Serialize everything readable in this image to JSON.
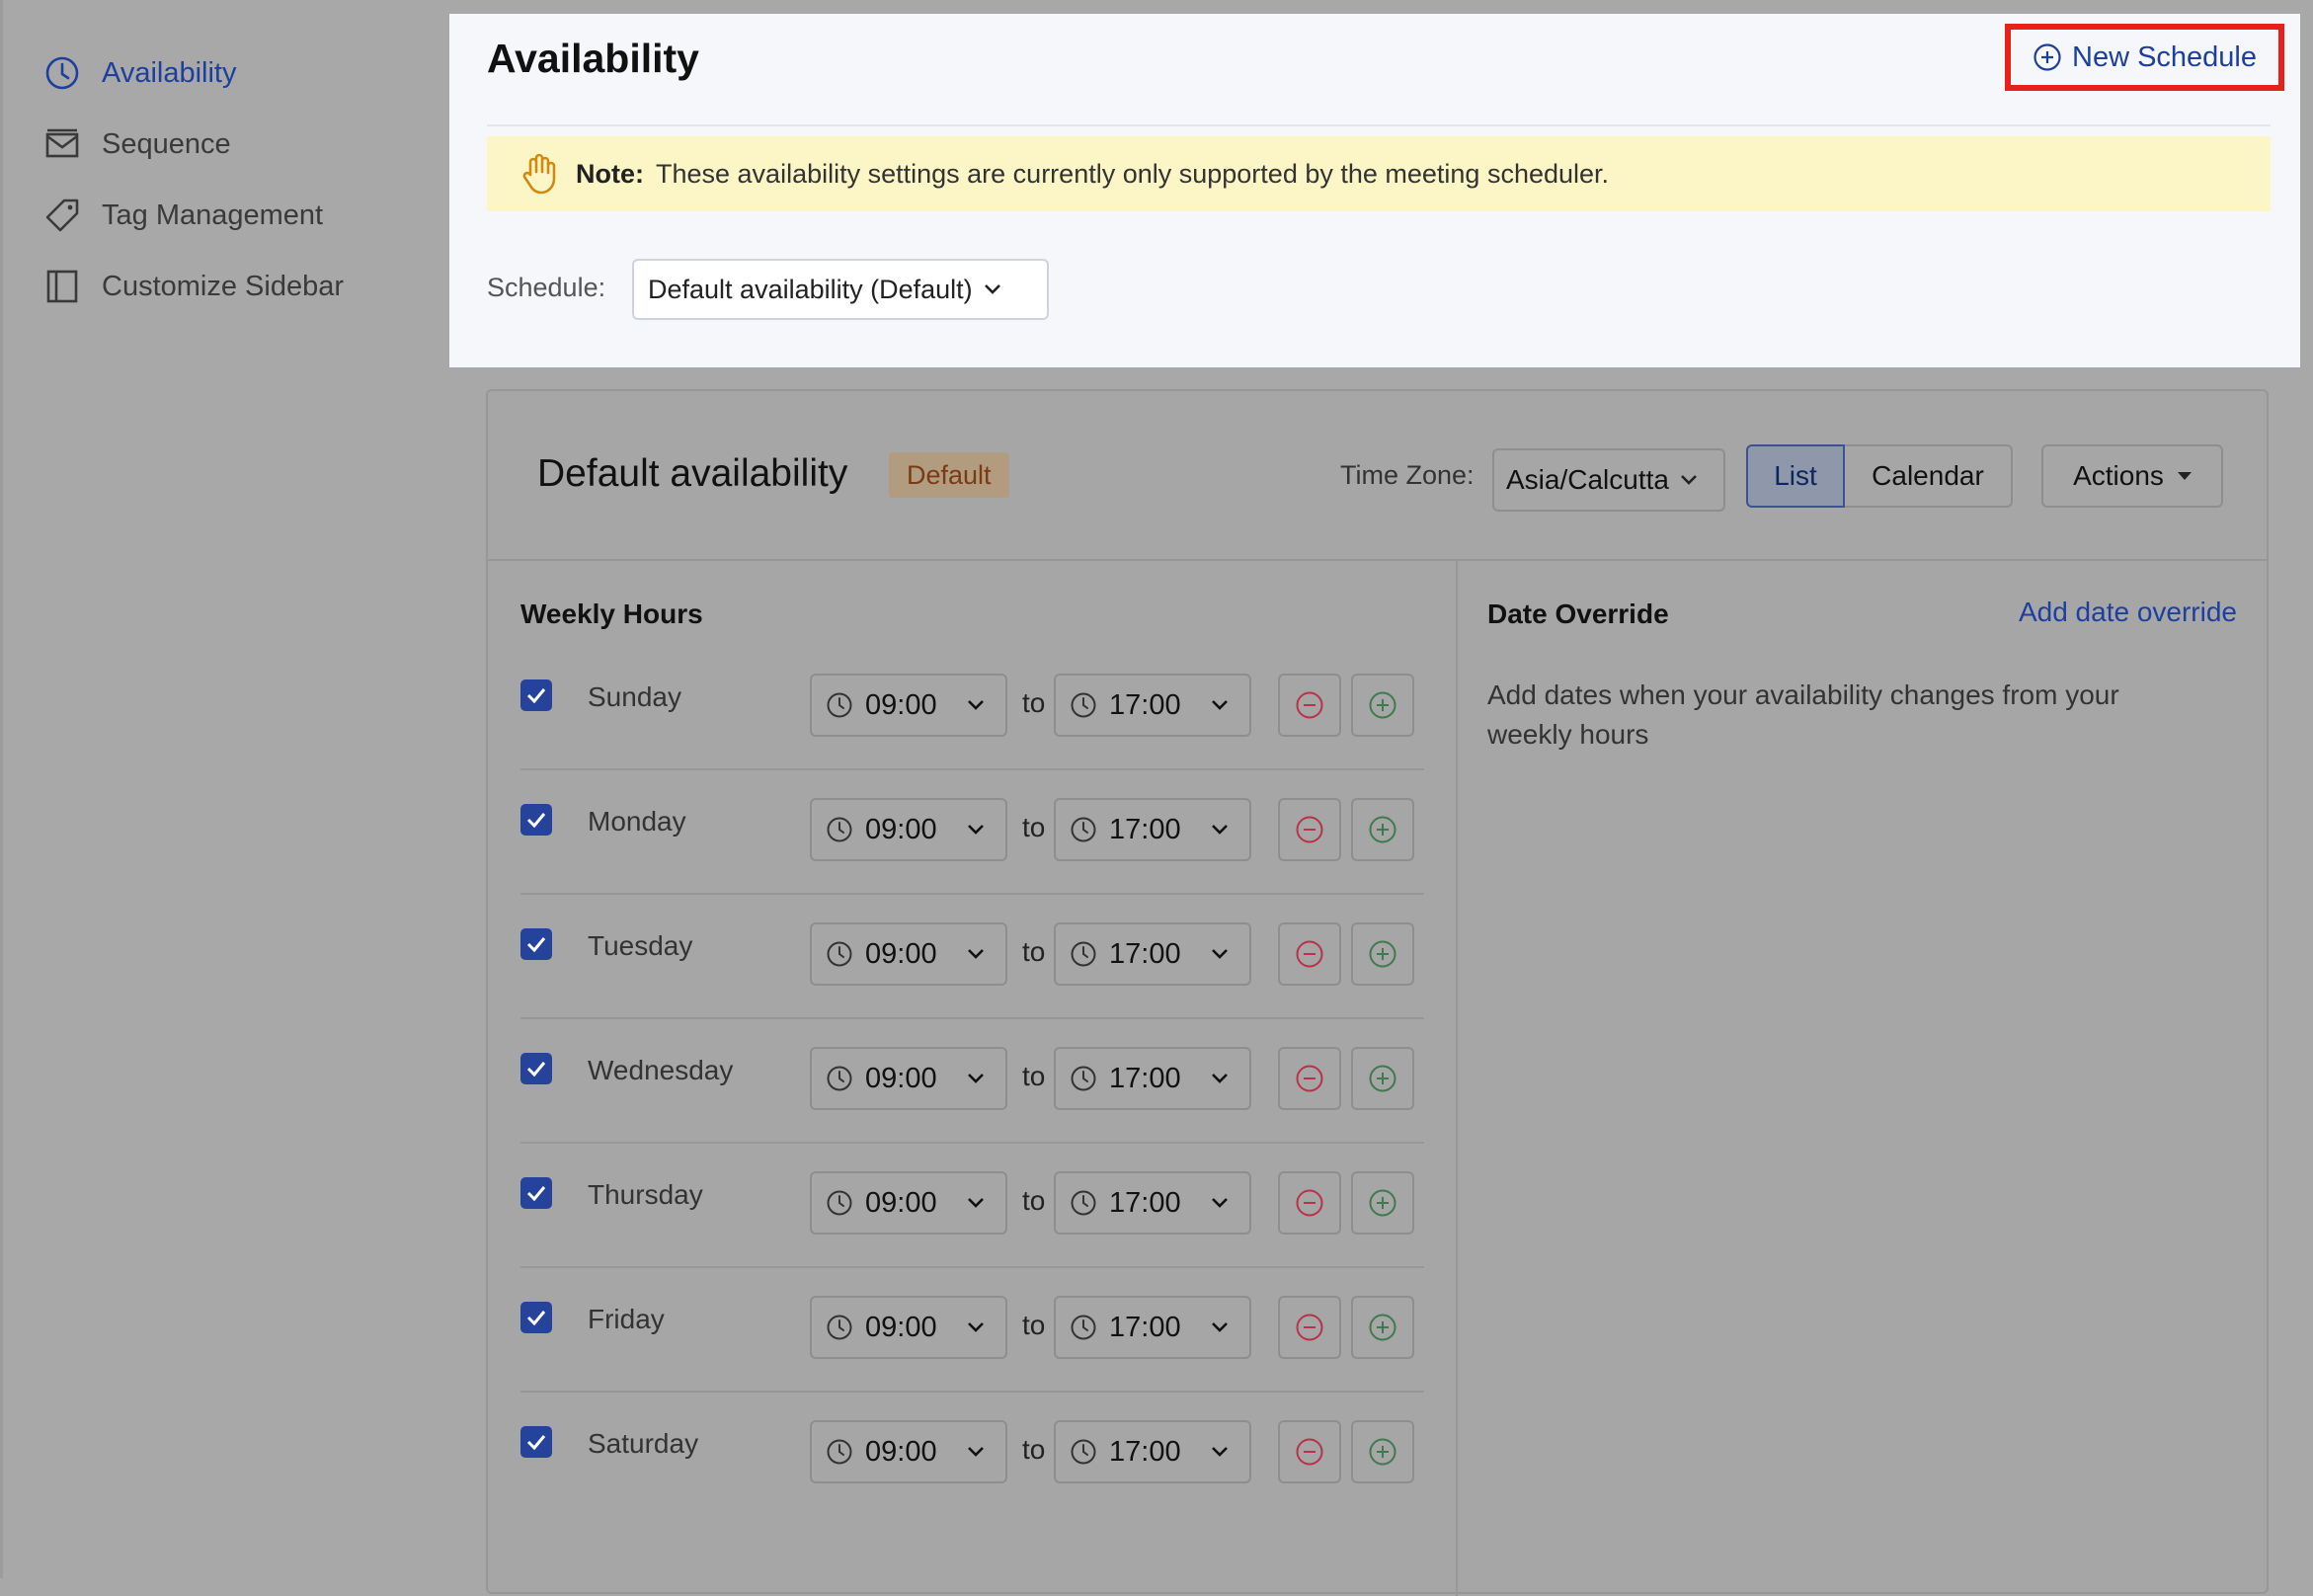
{
  "sidebar": {
    "items": [
      {
        "label": "Availability",
        "icon": "clock-icon",
        "active": true
      },
      {
        "label": "Sequence",
        "icon": "mail-icon",
        "active": false
      },
      {
        "label": "Tag Management",
        "icon": "tag-icon",
        "active": false
      },
      {
        "label": "Customize Sidebar",
        "icon": "sidebar-layout-icon",
        "active": false
      }
    ]
  },
  "header": {
    "title": "Availability",
    "new_schedule_label": "New Schedule",
    "note_bold": "Note:",
    "note_text": "These availability settings are currently only supported by the meeting scheduler.",
    "schedule_label": "Schedule:",
    "schedule_value": "Default availability (Default)"
  },
  "card": {
    "title": "Default availability",
    "badge": "Default",
    "timezone_label": "Time Zone:",
    "timezone_value": "Asia/Calcutta",
    "view_list": "List",
    "view_calendar": "Calendar",
    "actions_label": "Actions"
  },
  "weekly": {
    "title": "Weekly Hours",
    "to_label": "to",
    "days": [
      {
        "day": "Sunday",
        "checked": true,
        "start": "09:00",
        "end": "17:00"
      },
      {
        "day": "Monday",
        "checked": true,
        "start": "09:00",
        "end": "17:00"
      },
      {
        "day": "Tuesday",
        "checked": true,
        "start": "09:00",
        "end": "17:00"
      },
      {
        "day": "Wednesday",
        "checked": true,
        "start": "09:00",
        "end": "17:00"
      },
      {
        "day": "Thursday",
        "checked": true,
        "start": "09:00",
        "end": "17:00"
      },
      {
        "day": "Friday",
        "checked": true,
        "start": "09:00",
        "end": "17:00"
      },
      {
        "day": "Saturday",
        "checked": true,
        "start": "09:00",
        "end": "17:00"
      }
    ]
  },
  "override": {
    "title": "Date Override",
    "add_link": "Add date override",
    "description": "Add dates when your availability changes from your weekly hours"
  },
  "colors": {
    "accent": "#1d3f9e",
    "highlight_border": "#e8201b",
    "note_bg": "#fcf6c6",
    "remove_icon": "#b8324a",
    "add_icon": "#3f7a4f"
  }
}
